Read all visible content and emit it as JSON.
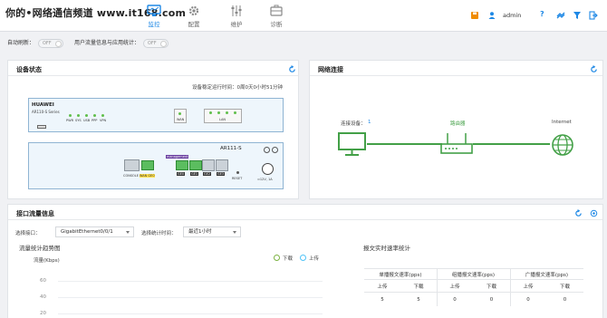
{
  "watermark": "你的•网络通信频道 www.it168.com",
  "nav": [
    {
      "label": "监控"
    },
    {
      "label": "配置"
    },
    {
      "label": "维护"
    },
    {
      "label": "诊断"
    }
  ],
  "topright": {
    "user": "admin",
    "help": "?"
  },
  "options": {
    "auto_refresh_label": "自动刷新：",
    "auto_refresh_state": "OFF",
    "traffic_stats_label": "用户流量信息与应用统计：",
    "traffic_stats_state": "OFF"
  },
  "device_panel": {
    "title": "设备状态",
    "uptime": "设备稳定运行时间：0周0天0小时51分钟",
    "brand": "HUAWEI",
    "series": "AR110-S Series",
    "led_labels": [
      "PWR",
      "SYS",
      "USB",
      "PPP",
      "VPN"
    ],
    "wan_label": "WAN",
    "lan_label": "LAN",
    "model": "AR111-S",
    "management": "management",
    "ports": [
      "CONSOLE",
      "WAN GE0",
      "GE0",
      "GE1",
      "GE2",
      "GE3"
    ],
    "reset": "RESET",
    "power": "≈12V, 1A"
  },
  "network_panel": {
    "title": "网络连接",
    "devices_label": "连接设备：",
    "devices_count": "1",
    "router_label": "路由器",
    "internet_label": "Internet"
  },
  "traffic_panel": {
    "title": "接口流量信息",
    "iface_label": "选择接口：",
    "iface_value": "GigabitEthernet0/0/1",
    "period_label": "选择统计时间：",
    "period_value": "最近1小时",
    "chart_title": "流量统计趋势图",
    "legend_down": "下载",
    "legend_up": "上传"
  },
  "chart_data": {
    "type": "line",
    "title": "流量统计趋势图",
    "ylabel": "流量(Kbps)",
    "yticks": [
      "60",
      "40",
      "20"
    ],
    "ylim": [
      0,
      60
    ],
    "series": [
      {
        "name": "下载",
        "values": []
      },
      {
        "name": "上传",
        "values": []
      }
    ],
    "legend": "top-right",
    "grid": true
  },
  "realtime": {
    "title": "报文实时速率统计",
    "groups": [
      "单播报文速率(pps)",
      "组播报文速率(pps)",
      "广播报文速率(pps)"
    ],
    "sub_headers": [
      "上传",
      "下载",
      "上传",
      "下载",
      "上传",
      "下载"
    ],
    "values": [
      "5",
      "5",
      "0",
      "0",
      "0",
      "0"
    ]
  },
  "colors": {
    "accent": "#1e88e5",
    "green": "#43a047",
    "orange": "#f08c00"
  }
}
